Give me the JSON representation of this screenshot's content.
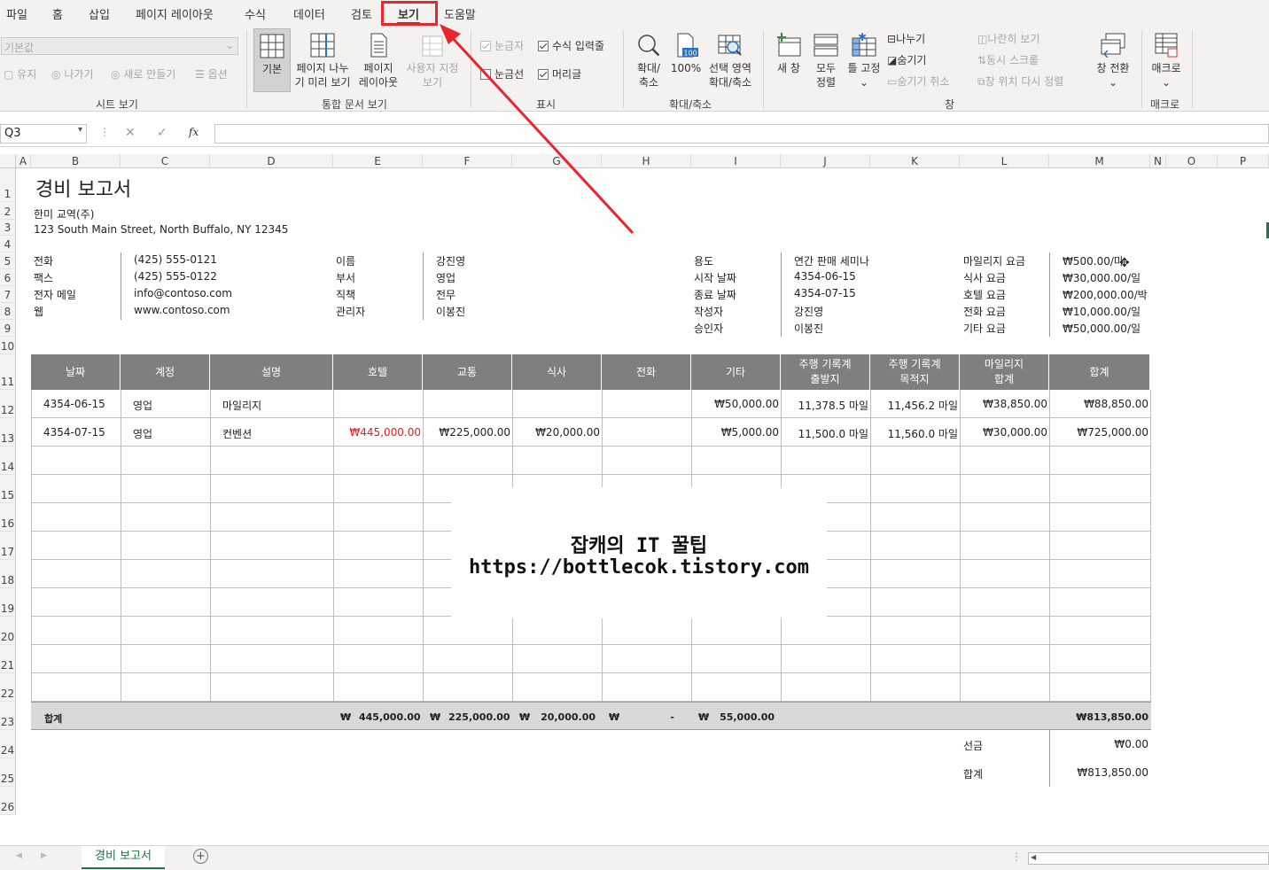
{
  "menu": [
    "파일",
    "홈",
    "삽입",
    "페이지 레이아웃",
    "수식",
    "데이터",
    "검토",
    "보기",
    "도움말"
  ],
  "ribbon": {
    "sheet_view": {
      "dropdown": "기본값",
      "keep": "유지",
      "exit": "나가기",
      "new": "새로 만들기",
      "options": "옵션",
      "label": "시트 보기"
    },
    "workbook_views": {
      "normal": "기본",
      "page_break": [
        "페이지 나누",
        "기 미리 보기"
      ],
      "page_layout": [
        "페이지",
        "레이아웃"
      ],
      "custom": [
        "사용자 지정",
        "보기"
      ],
      "label": "통합 문서 보기"
    },
    "show": {
      "ruler": "눈금자",
      "formula_bar": "수식 입력줄",
      "gridlines": "눈금선",
      "headings": "머리글",
      "label": "표시"
    },
    "zoom": {
      "zoom": [
        "확대/",
        "축소"
      ],
      "hundred": "100%",
      "selection": [
        "선택 영역",
        "확대/축소"
      ],
      "label": "확대/축소",
      "badge": "100"
    },
    "window": {
      "new": "새 창",
      "arrange": [
        "모두",
        "정렬"
      ],
      "freeze": [
        "틀 고정",
        "⌄"
      ],
      "split": "나누기",
      "hide": "숨기기",
      "unhide": "숨기기 취소",
      "side": "나란히 보기",
      "sync": "동시 스크롤",
      "reset": "창 위치 다시 정렬",
      "switch": [
        "창 전환",
        "⌄"
      ],
      "label": "창"
    },
    "macro": {
      "macro": [
        "매크로",
        "⌄"
      ],
      "label": "매크로"
    }
  },
  "formula_bar": {
    "name_box": "Q3",
    "cancel": "✕",
    "enter": "✓",
    "fx": "fx"
  },
  "columns": [
    "A",
    "B",
    "C",
    "D",
    "E",
    "F",
    "G",
    "H",
    "I",
    "J",
    "K",
    "L",
    "M",
    "N",
    "O",
    "P"
  ],
  "rows": [
    "1",
    "2",
    "3",
    "4",
    "5",
    "6",
    "7",
    "8",
    "9",
    "10",
    "11",
    "12",
    "13",
    "14",
    "15",
    "16",
    "17",
    "18",
    "19",
    "20",
    "21",
    "22",
    "23",
    "24",
    "25",
    "26"
  ],
  "report": {
    "title": "경비 보고서",
    "company": "한미 교역(주)",
    "address": "123 South Main Street, North Buffalo, NY 12345",
    "contact_labels": [
      "전화",
      "팩스",
      "전자 메일",
      "웹"
    ],
    "contact_values": [
      "(425) 555-0121",
      "(425) 555-0122",
      "info@contoso.com",
      "www.contoso.com"
    ],
    "person_labels": [
      "이름",
      "부서",
      "직책",
      "관리자"
    ],
    "person_values": [
      "강진영",
      "영업",
      "전무",
      "이봉진"
    ],
    "purpose_labels": [
      "용도",
      "시작 날짜",
      "종료 날짜",
      "작성자",
      "승인자"
    ],
    "purpose_values": [
      "연간 판매 세미나",
      "4354-06-15",
      "4354-07-15",
      "강진영",
      "이봉진"
    ],
    "rate_labels": [
      "마일리지 요금",
      "식사 요금",
      "호텔 요금",
      "전화 요금",
      "기타 요금"
    ],
    "rate_values": [
      "₩500.00/마",
      "₩30,000.00/일",
      "₩200,000.00/박",
      "₩10,000.00/일",
      "₩50,000.00/일"
    ]
  },
  "table": {
    "headers": [
      "날짜",
      "계정",
      "설명",
      "호텔",
      "교통",
      "식사",
      "전화",
      "기타",
      "주행 기록계\n출발지",
      "주행 기록계\n목적지",
      "마일리지\n합계",
      "합계"
    ],
    "rows": [
      [
        "4354-06-15",
        "영업",
        "마일리지",
        "",
        "",
        "",
        "",
        "₩50,000.00",
        "11,378.5 마일",
        "11,456.2 마일",
        "₩38,850.00",
        "₩88,850.00"
      ],
      [
        "4354-07-15",
        "영업",
        "컨벤션",
        "₩445,000.00",
        "₩225,000.00",
        "₩20,000.00",
        "",
        "₩5,000.00",
        "11,500.0 마일",
        "11,560.0 마일",
        "₩30,000.00",
        "₩725,000.00"
      ]
    ],
    "total_label": "합계",
    "currency": "₩",
    "totals": {
      "hotel": "445,000.00",
      "transport": "225,000.00",
      "meal": "20,000.00",
      "phone": "-",
      "other": "55,000.00",
      "grand": "₩813,850.00"
    },
    "advance_label": "선금",
    "advance_value": "₩0.00",
    "sum_label": "합계",
    "sum_value": "₩813,850.00",
    "highlight_color": "#e02020"
  },
  "watermark": {
    "line1": "잡캐의 IT 꿀팁",
    "line2": "https://bottlecok.tistory.com"
  },
  "sheet_tab": "경비 보고서",
  "colors": {
    "accent": "#217346",
    "annotation": "#e8262c",
    "header_fill": "#7f7f7f",
    "total_fill": "#d9d9d9"
  }
}
